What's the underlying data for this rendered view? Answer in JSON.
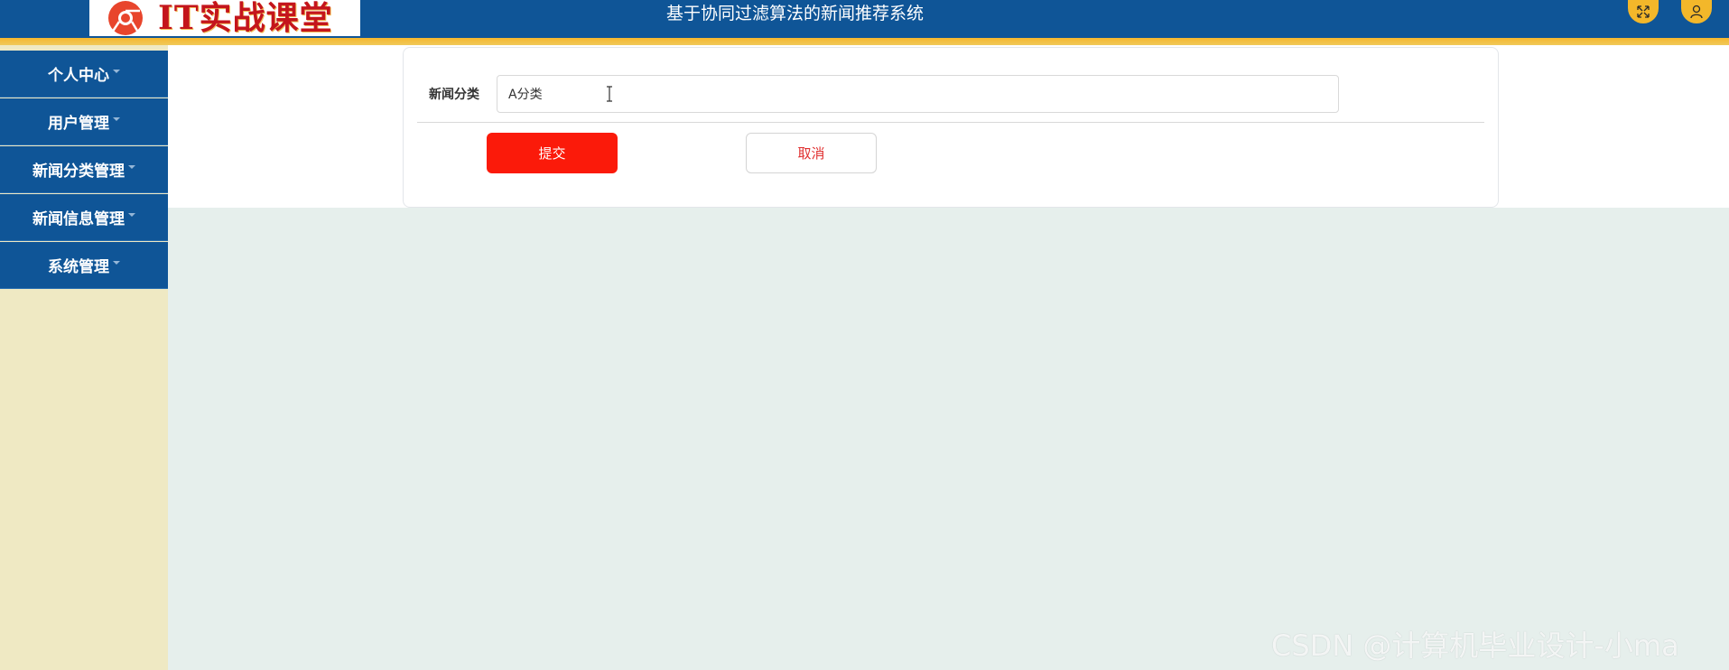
{
  "header": {
    "logo_text": "IT实战课堂",
    "title": "基于协同过滤算法的新闻推荐系统",
    "fullscreen_icon": "fullscreen-icon",
    "user_icon": "user-icon",
    "colors": {
      "bar": "#0f5597",
      "stripe": "#f5b72e",
      "button": "#f3b72a"
    }
  },
  "sidebar": {
    "items": [
      {
        "label": "个人中心"
      },
      {
        "label": "用户管理"
      },
      {
        "label": "新闻分类管理"
      },
      {
        "label": "新闻信息管理"
      },
      {
        "label": "系统管理"
      }
    ]
  },
  "form": {
    "field_label": "新闻分类",
    "field_value": "A分类",
    "submit_label": "提交",
    "cancel_label": "取消",
    "colors": {
      "submit": "#fb1a0a",
      "cancel_text": "#e03030"
    }
  },
  "watermark": "CSDN @计算机毕业设计-小ma"
}
